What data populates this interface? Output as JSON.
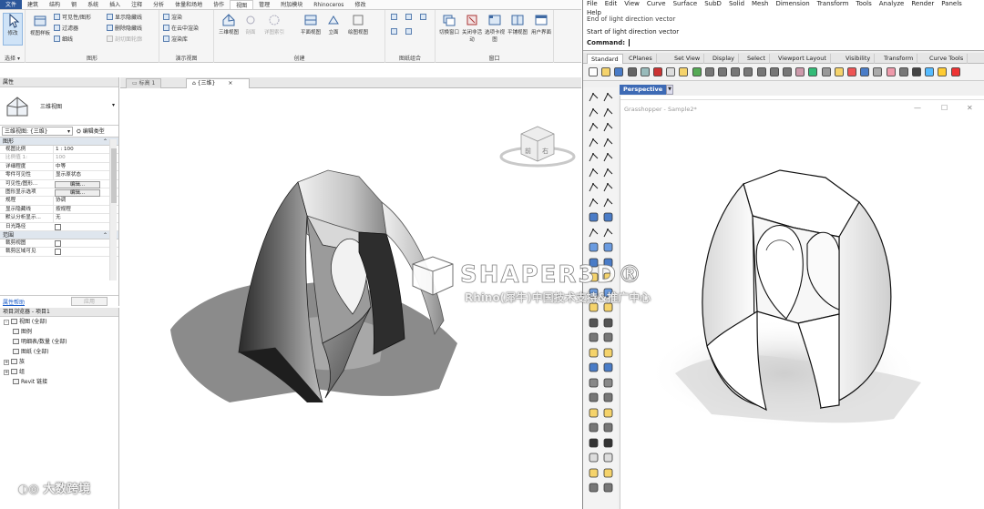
{
  "revit": {
    "menu_tabs": [
      "文件",
      "建筑",
      "结构",
      "钢",
      "系统",
      "插入",
      "注释",
      "分析",
      "体量和场地",
      "协作",
      "视图",
      "管理",
      "附加模块",
      "Rhinoceros",
      "修改"
    ],
    "active_tab_index": 10,
    "ribbon": {
      "modify_label": "修改",
      "select_label": "选择",
      "view_template_label": "视图样板",
      "visibility_graphics_label": "可见性/图形",
      "filters_label": "过滤器",
      "thin_lines_label": "细线",
      "show_hidden_label": "显示隐藏线",
      "remove_hidden_label": "删除隐藏线",
      "cut_profile_label": "剖切面轮廓",
      "render_label": "渲染",
      "render_cloud_label": "在云中渲染",
      "render_gallery_label": "渲染库",
      "graphics_group": "图形",
      "presentation_group": "演示视图",
      "view_3d_label": "三维视图",
      "section_label": "剖面",
      "callout_label": "详图索引",
      "plan_label": "平面视图",
      "elevation_label": "立面",
      "drafting_label": "绘图视图",
      "create_group": "创建",
      "sheet_group": "图纸组合",
      "switch_windows_label": "切换窗口",
      "close_hidden_label": "关闭非活动",
      "tab_views_label": "选项卡视图",
      "tile_views_label": "平铺视图",
      "user_interface_label": "用户界面",
      "window_group": "窗口"
    },
    "doc_tabs": [
      {
        "label": "标高 1",
        "active": false
      },
      {
        "label": "{三维}",
        "active": true
      }
    ],
    "properties": {
      "title": "属性",
      "type_name": "三维视图",
      "view_selector": "三维视图: {三维}",
      "edit_type_label": "编辑类型",
      "section_graphics": "图形",
      "rows": [
        {
          "k": "视图比例",
          "v": "1 : 100",
          "grey": false
        },
        {
          "k": "比例值 1:",
          "v": "100",
          "grey": true
        },
        {
          "k": "详细程度",
          "v": "中等",
          "grey": false
        },
        {
          "k": "零件可见性",
          "v": "显示原状态",
          "grey": false
        },
        {
          "k": "可见性/图形...",
          "btn": "编辑..."
        },
        {
          "k": "图形显示选项",
          "btn": "编辑..."
        },
        {
          "k": "规程",
          "v": "协调",
          "grey": false
        },
        {
          "k": "显示隐藏线",
          "v": "按规程",
          "grey": false
        },
        {
          "k": "默认分析显示...",
          "v": "无",
          "grey": false
        },
        {
          "k": "日光路径",
          "cb": true
        }
      ],
      "section_extents": "范围",
      "rows2": [
        {
          "k": "裁剪视图",
          "cb": true
        },
        {
          "k": "裁剪区域可见",
          "cb": true
        }
      ],
      "help_link": "属性帮助",
      "apply_label": "应用"
    },
    "project_browser": {
      "title": "项目浏览器 - 项目1",
      "items": [
        {
          "label": "视图 (全部)",
          "level": 0,
          "pm": "-"
        },
        {
          "label": "图例",
          "level": 1,
          "pm": ""
        },
        {
          "label": "明细表/数量 (全部)",
          "level": 1,
          "pm": ""
        },
        {
          "label": "图纸 (全部)",
          "level": 1,
          "pm": ""
        },
        {
          "label": "族",
          "level": 0,
          "pm": "+"
        },
        {
          "label": "组",
          "level": 0,
          "pm": "+"
        },
        {
          "label": "Revit 链接",
          "level": 1,
          "pm": ""
        }
      ]
    },
    "viewcube": {
      "front": "前",
      "right": "右"
    }
  },
  "rhino": {
    "menus": [
      "File",
      "Edit",
      "View",
      "Curve",
      "Surface",
      "SubD",
      "Solid",
      "Mesh",
      "Dimension",
      "Transform",
      "Tools",
      "Analyze",
      "Render",
      "Panels"
    ],
    "menus_row2": [
      "Help"
    ],
    "cmd_history": [
      "End of light direction vector",
      "Start of light direction vector"
    ],
    "cmd_label": "Command:",
    "tabs": [
      "Standard",
      "CPlanes",
      "Set View",
      "Display",
      "Select",
      "Viewport Layout",
      "Visibility",
      "Transform",
      "Curve Tools"
    ],
    "active_tab": "Standard",
    "viewport_label": "Perspective",
    "gh_title": "Grasshopper - Sample2*",
    "gh_ctrl_min": "—",
    "gh_ctrl_max": "☐",
    "gh_ctrl_close": "✕"
  },
  "watermark": {
    "logo": "SHAPER3D®",
    "subtitle": "Rhino(犀牛)中国技术支持&推广中心",
    "bottom": "大数跨境"
  }
}
